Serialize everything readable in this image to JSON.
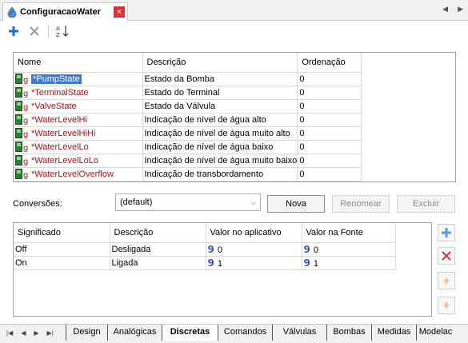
{
  "document_tab": {
    "title": "ConfiguracaoWater",
    "close": "×"
  },
  "tags_table": {
    "columns": [
      "Nome",
      "Descrição",
      "Ordenação"
    ],
    "rows": [
      {
        "name": "*PumpState",
        "description": "Estado da Bomba",
        "order": "0"
      },
      {
        "name": "*TerminalState",
        "description": "Estado do Terminal",
        "order": "0"
      },
      {
        "name": "*ValveState",
        "description": "Estado da Válvula",
        "order": "0"
      },
      {
        "name": "*WaterLevelHi",
        "description": "Indicação de nível de água alto",
        "order": "0"
      },
      {
        "name": "*WaterLevelHiHi",
        "description": "Indicação de nível de água muito alto",
        "order": "0"
      },
      {
        "name": "*WaterLevelLo",
        "description": "Indicação de nível de água baixo",
        "order": "0"
      },
      {
        "name": "*WaterLevelLoLo",
        "description": "Indicação de nível de água muito baixo",
        "order": "0"
      },
      {
        "name": "*WaterLevelOverflow",
        "description": "Indicação de transbordamento",
        "order": "0"
      }
    ]
  },
  "conversions": {
    "label": "Conversões:",
    "selected": "(default)",
    "buttons": {
      "new": "Nova",
      "rename": "Renomear",
      "delete": "Excluir"
    }
  },
  "conversion_table": {
    "columns": [
      "Significado",
      "Descrição",
      "Valor no aplicativo",
      "Valor na Fonte"
    ],
    "rows": [
      {
        "meaning": "Off",
        "description": "Desligada",
        "app_value": "0",
        "source_value": "0"
      },
      {
        "meaning": "On",
        "description": "Ligada",
        "app_value": "1",
        "source_value": "1"
      }
    ]
  },
  "sheet_tabs": [
    "Design",
    "Analógicas",
    "Discretas",
    "Comandos",
    "Válvulas",
    "Bombas",
    "Medidas",
    "Modelac"
  ],
  "active_sheet_tab": "Discretas",
  "colors": {
    "accent": "#3c78d8",
    "tag_name": "#b01010",
    "close": "#d8343a",
    "add_icon": "#1e6fc4"
  }
}
